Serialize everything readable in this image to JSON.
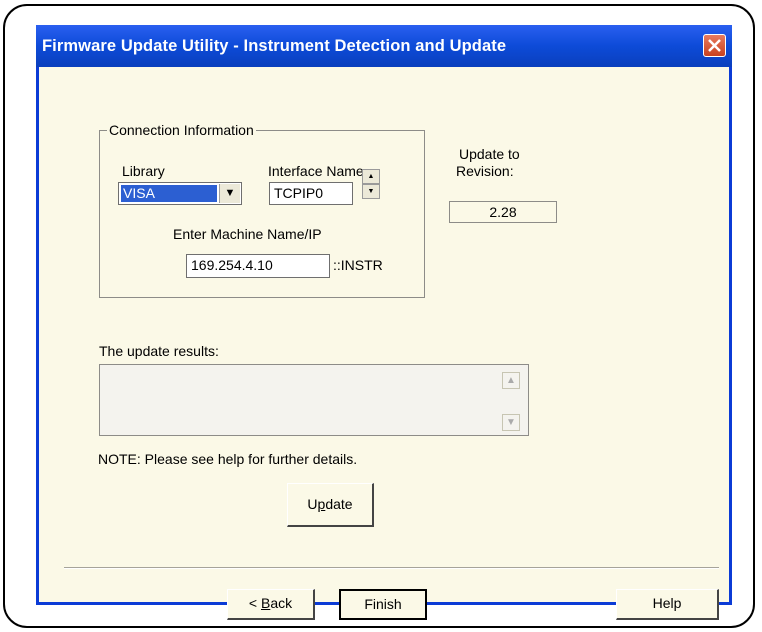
{
  "window": {
    "title": "Firmware Update Utility - Instrument Detection and Update",
    "close_glyph": "✕"
  },
  "connection": {
    "group_label": "Connection Information",
    "library_label": "Library",
    "library_value": "VISA",
    "interface_label": "Interface Name",
    "interface_value": "TCPIP0",
    "machine_label": "Enter Machine Name/IP",
    "machine_value": "169.254.4.10",
    "suffix": "::INSTR"
  },
  "revision": {
    "label_line1": "Update to",
    "label_line2": "Revision:",
    "value": "2.28"
  },
  "results": {
    "label": "The update results:",
    "value": ""
  },
  "note": "NOTE: Please see help for further details.",
  "buttons": {
    "update_pre": "U",
    "update_u": "p",
    "update_post": "date",
    "back_pre": "< ",
    "back_u": "B",
    "back_post": "ack",
    "finish": "Finish",
    "help": "Help"
  },
  "colors": {
    "titlebar": "#0d4bd8",
    "dialog_bg": "#fbf9e7",
    "close": "#d9532b"
  }
}
